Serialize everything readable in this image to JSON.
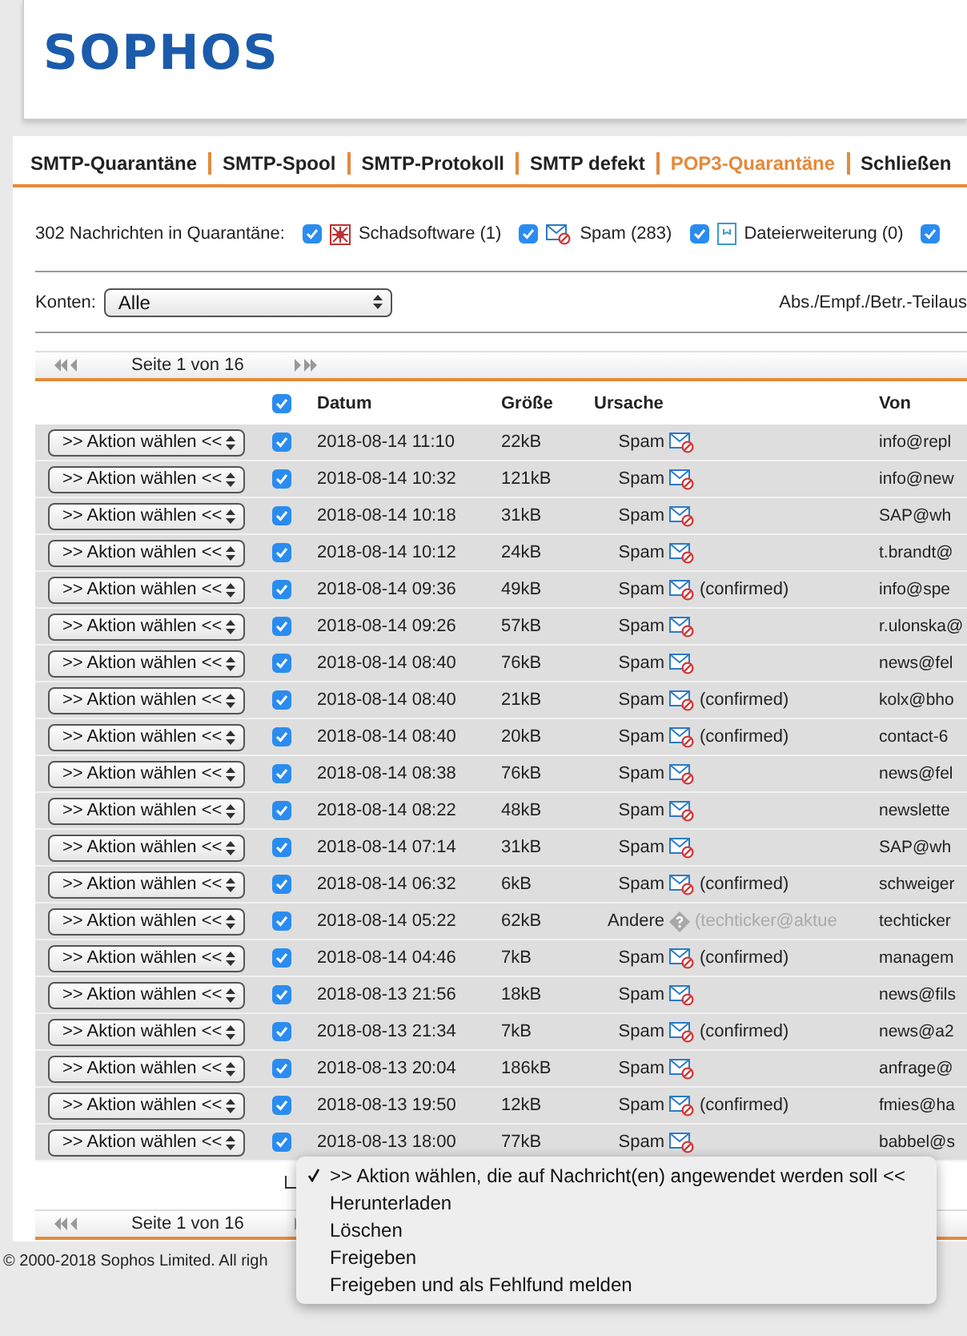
{
  "logo": "SOPHOS",
  "nav": [
    {
      "label": "SMTP-Quarantäne",
      "selected": false
    },
    {
      "label": "SMTP-Spool",
      "selected": false
    },
    {
      "label": "SMTP-Protokoll",
      "selected": false
    },
    {
      "label": "SMTP defekt",
      "selected": false
    },
    {
      "label": "POP3-Quarantäne",
      "selected": true
    },
    {
      "label": "Schließen",
      "selected": false
    }
  ],
  "filters": {
    "summary": "302 Nachrichten in Quarantäne:",
    "items": [
      {
        "kind": "malware",
        "label": "Schadsoftware (1)",
        "checked": true
      },
      {
        "kind": "spam",
        "label": "Spam (283)",
        "checked": true
      },
      {
        "kind": "file",
        "label": "Dateierweiterung (0)",
        "checked": true
      },
      {
        "kind": "none",
        "checked": true
      }
    ]
  },
  "accounts": {
    "label": "Konten:",
    "value": "Alle",
    "search_label": "Abs./Empf./Betr.-Teilaus"
  },
  "pager_top": {
    "text": "Seite 1 von 16"
  },
  "table": {
    "select_all": true,
    "columns": [
      "Datum",
      "Größe",
      "Ursache",
      "Von"
    ],
    "rows": [
      {
        "action": ">> Aktion wählen <<",
        "checked": true,
        "date": "2018-08-14 11:10",
        "size": "22kB",
        "reason": {
          "kind": "spam",
          "label": "Spam"
        },
        "from": "info@repl"
      },
      {
        "action": ">> Aktion wählen <<",
        "checked": true,
        "date": "2018-08-14 10:32",
        "size": "121kB",
        "reason": {
          "kind": "spam",
          "label": "Spam"
        },
        "from": "info@new"
      },
      {
        "action": ">> Aktion wählen <<",
        "checked": true,
        "date": "2018-08-14 10:18",
        "size": "31kB",
        "reason": {
          "kind": "spam",
          "label": "Spam"
        },
        "from": "SAP@wh"
      },
      {
        "action": ">> Aktion wählen <<",
        "checked": true,
        "date": "2018-08-14 10:12",
        "size": "24kB",
        "reason": {
          "kind": "spam",
          "label": "Spam"
        },
        "from": "t.brandt@"
      },
      {
        "action": ">> Aktion wählen <<",
        "checked": true,
        "date": "2018-08-14 09:36",
        "size": "49kB",
        "reason": {
          "kind": "spam",
          "label": "Spam",
          "note": "(confirmed)"
        },
        "from": "info@spe"
      },
      {
        "action": ">> Aktion wählen <<",
        "checked": true,
        "date": "2018-08-14 09:26",
        "size": "57kB",
        "reason": {
          "kind": "spam",
          "label": "Spam"
        },
        "from": "r.ulonska@"
      },
      {
        "action": ">> Aktion wählen <<",
        "checked": true,
        "date": "2018-08-14 08:40",
        "size": "76kB",
        "reason": {
          "kind": "spam",
          "label": "Spam"
        },
        "from": "news@fel"
      },
      {
        "action": ">> Aktion wählen <<",
        "checked": true,
        "date": "2018-08-14 08:40",
        "size": "21kB",
        "reason": {
          "kind": "spam",
          "label": "Spam",
          "note": "(confirmed)"
        },
        "from": "kolx@bho"
      },
      {
        "action": ">> Aktion wählen <<",
        "checked": true,
        "date": "2018-08-14 08:40",
        "size": "20kB",
        "reason": {
          "kind": "spam",
          "label": "Spam",
          "note": "(confirmed)"
        },
        "from": "contact-6"
      },
      {
        "action": ">> Aktion wählen <<",
        "checked": true,
        "date": "2018-08-14 08:38",
        "size": "76kB",
        "reason": {
          "kind": "spam",
          "label": "Spam"
        },
        "from": "news@fel"
      },
      {
        "action": ">> Aktion wählen <<",
        "checked": true,
        "date": "2018-08-14 08:22",
        "size": "48kB",
        "reason": {
          "kind": "spam",
          "label": "Spam"
        },
        "from": "newslette"
      },
      {
        "action": ">> Aktion wählen <<",
        "checked": true,
        "date": "2018-08-14 07:14",
        "size": "31kB",
        "reason": {
          "kind": "spam",
          "label": "Spam"
        },
        "from": "SAP@wh"
      },
      {
        "action": ">> Aktion wählen <<",
        "checked": true,
        "date": "2018-08-14 06:32",
        "size": "6kB",
        "reason": {
          "kind": "spam",
          "label": "Spam",
          "note": "(confirmed)"
        },
        "from": "schweiger"
      },
      {
        "action": ">> Aktion wählen <<",
        "checked": true,
        "date": "2018-08-14 05:22",
        "size": "62kB",
        "reason": {
          "kind": "other",
          "label": "Andere",
          "note": "(techticker@aktue"
        },
        "from": "techticker"
      },
      {
        "action": ">> Aktion wählen <<",
        "checked": true,
        "date": "2018-08-14 04:46",
        "size": "7kB",
        "reason": {
          "kind": "spam",
          "label": "Spam",
          "note": "(confirmed)"
        },
        "from": "managem"
      },
      {
        "action": ">> Aktion wählen <<",
        "checked": true,
        "date": "2018-08-13 21:56",
        "size": "18kB",
        "reason": {
          "kind": "spam",
          "label": "Spam"
        },
        "from": "news@fils"
      },
      {
        "action": ">> Aktion wählen <<",
        "checked": true,
        "date": "2018-08-13 21:34",
        "size": "7kB",
        "reason": {
          "kind": "spam",
          "label": "Spam",
          "note": "(confirmed)"
        },
        "from": "news@a2"
      },
      {
        "action": ">> Aktion wählen <<",
        "checked": true,
        "date": "2018-08-13 20:04",
        "size": "186kB",
        "reason": {
          "kind": "spam",
          "label": "Spam"
        },
        "from": "anfrage@"
      },
      {
        "action": ">> Aktion wählen <<",
        "checked": true,
        "date": "2018-08-13 19:50",
        "size": "12kB",
        "reason": {
          "kind": "spam",
          "label": "Spam",
          "note": "(confirmed)"
        },
        "from": "fmies@ha"
      },
      {
        "action": ">> Aktion wählen <<",
        "checked": true,
        "date": "2018-08-13 18:00",
        "size": "77kB",
        "reason": {
          "kind": "spam",
          "label": "Spam"
        },
        "from": "babbel@s"
      }
    ]
  },
  "bulk_menu": {
    "items": [
      {
        "label": ">> Aktion wählen, die auf Nachricht(en) angewendet werden soll <<",
        "selected": true
      },
      {
        "label": "Herunterladen",
        "selected": false
      },
      {
        "label": "Löschen",
        "selected": false
      },
      {
        "label": "Freigeben",
        "selected": false
      },
      {
        "label": "Freigeben und als Fehlfund melden",
        "selected": false
      }
    ]
  },
  "pager_bottom": {
    "text": "Seite 1 von 16"
  },
  "footer": "© 2000-2018 Sophos Limited. All righ"
}
